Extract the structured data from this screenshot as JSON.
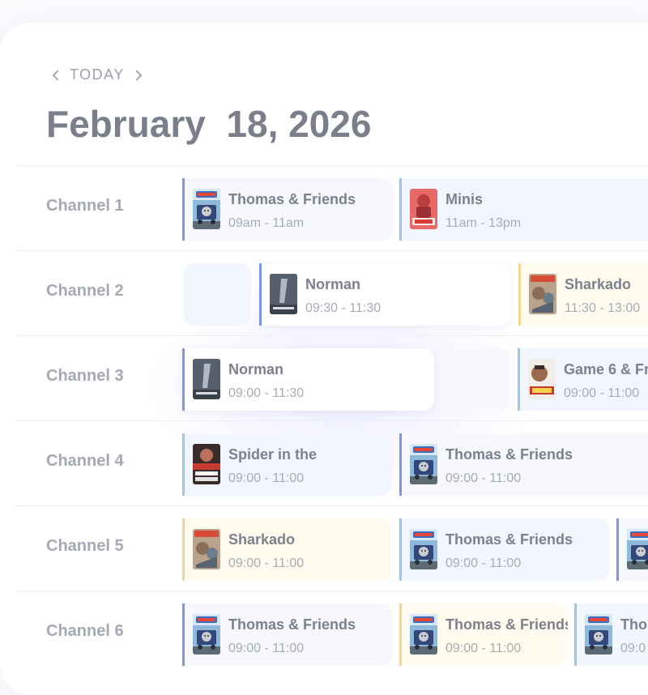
{
  "nav": {
    "today_label": "TODAY",
    "prev_icon": "chevron-left-icon",
    "next_icon": "chevron-right-icon"
  },
  "date_title": "February  18, 2026",
  "colors": {
    "accent_blue": "#7e95e8",
    "accent_light_blue": "#9dc6ec",
    "accent_yellow": "#f3d68d"
  },
  "channels": [
    {
      "label": "Channel 1",
      "programs": [
        {
          "title": "Thomas & Friends",
          "time": "09am - 11am",
          "poster": "thomas-poster"
        },
        {
          "title": "Minis",
          "time": "11am - 13pm",
          "poster": "minis-poster"
        }
      ]
    },
    {
      "label": "Channel 2",
      "programs": [
        {
          "title": "Norman",
          "time": "09:30 - 11:30",
          "poster": "norman-poster"
        },
        {
          "title": "Sharkado",
          "time": "11:30 - 13:00",
          "poster": "sharkado-poster"
        }
      ]
    },
    {
      "label": "Channel 3",
      "programs": [
        {
          "title": "Norman",
          "time": "09:00 - 11:30",
          "poster": "norman-poster"
        },
        {
          "title": "Game 6 & Fr",
          "time": "09:00 - 11:00",
          "poster": "game6-poster"
        }
      ]
    },
    {
      "label": "Channel 4",
      "programs": [
        {
          "title": "Spider in the",
          "time": "09:00 - 11:00",
          "poster": "spider-poster"
        },
        {
          "title": "Thomas & Friends",
          "time": "09:00 - 11:00",
          "poster": "thomas-poster"
        }
      ]
    },
    {
      "label": "Channel 5",
      "programs": [
        {
          "title": "Sharkado",
          "time": "09:00 - 11:00",
          "poster": "sharkado-poster"
        },
        {
          "title": "Thomas & Friends",
          "time": "09:00 - 11:00",
          "poster": "thomas-poster"
        },
        {
          "title": "",
          "time": "",
          "poster": "thomas-poster"
        }
      ]
    },
    {
      "label": "Channel 6",
      "programs": [
        {
          "title": "Thomas & Friends",
          "time": "09:00 - 11:00",
          "poster": "thomas-poster"
        },
        {
          "title": "Thomas & Friends",
          "time": "09:00 - 11:00",
          "poster": "thomas-poster"
        },
        {
          "title": "Tho",
          "time": "09:0",
          "poster": "thomas-poster"
        }
      ]
    }
  ]
}
